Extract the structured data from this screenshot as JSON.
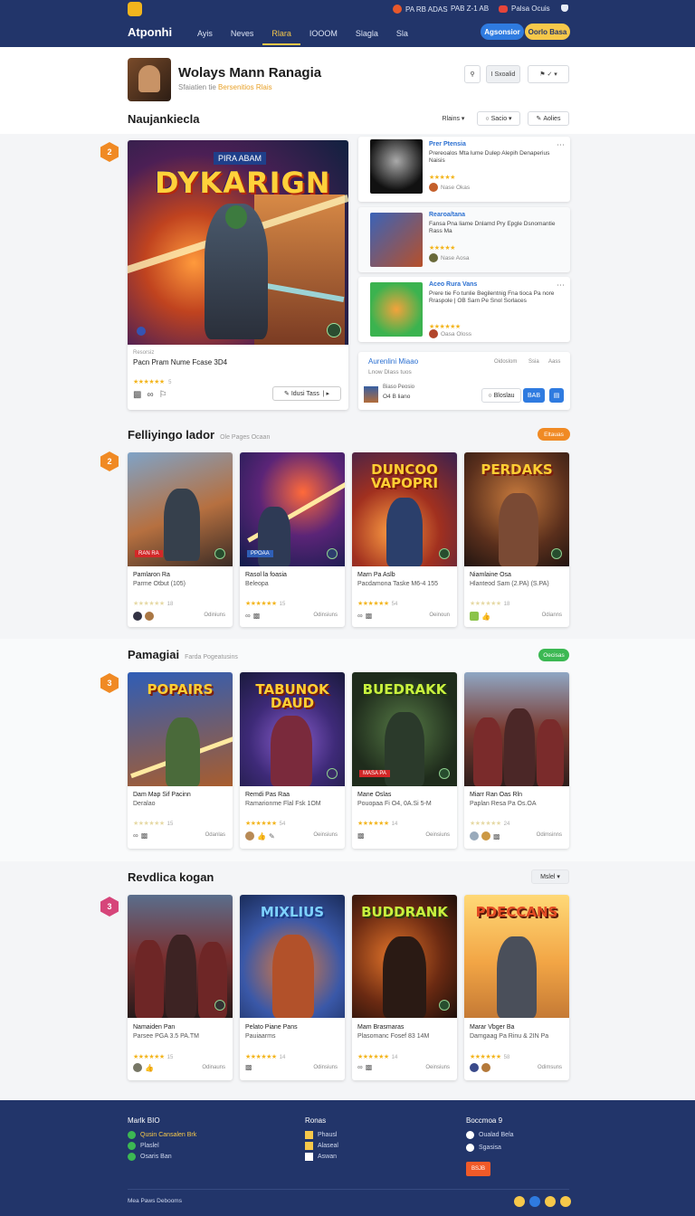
{
  "topbar": {
    "brand": "Atponhi",
    "nav": [
      "Ayis",
      "Neves",
      "Rlara",
      "IOOOM",
      "Slagla",
      "Sla"
    ],
    "active_nav": 2,
    "util": {
      "item1": "PA RB ADAS",
      "item2": "PAB Z-1 AB",
      "item3": "Palsa Ocuis"
    },
    "btn_primary": "Agsonsior",
    "btn_secondary": "Oorlo Basa"
  },
  "header": {
    "title": "Wolays Mann Ranagia",
    "subtitle_gray": "Sfaiatien tie",
    "subtitle_accent": "Bersenitios Rlais",
    "btn_share": "I Sxoalid",
    "btn_more": "✓"
  },
  "section1": {
    "title": "Naujankiecla",
    "badge": "2",
    "ctrl_sort": "Rlains",
    "ctrl_filter": "Sacio",
    "ctrl_add": "Aolies"
  },
  "featured": {
    "tag": "PIRA ABAM",
    "art_title": "DYKARIGN",
    "meta": "Resorsiz",
    "name": "Pacn Pram Nume Fcase 3D4",
    "stars": "★★★★★★",
    "rating_small": "5",
    "button": "Idusi Tass"
  },
  "side_items": [
    {
      "t1": "Prer Ptensia",
      "t2": "Prereoalos Mta lume Dulep Alepih Denaperius Naisis",
      "stars": "★★★★★",
      "small": "Nase Okas"
    },
    {
      "t1": "Rearoa/tana",
      "t2": "Fansa Pna liame Dnlamd Pry Epgle Dsnomantie Rass Ma",
      "stars": "★★★★★",
      "small": "Nase Aosa"
    },
    {
      "t1": "Aceo Rura Vans",
      "t2": "Prere tie Fo tunlie Begilentnig Fna tioca Pa nore Rraspole | OB Sarn Pe Snol Sorlaces",
      "stars": "★★★★★★",
      "small": "Oasa Oloss"
    }
  ],
  "side_footer": {
    "t1": "Aurenlini Miaao",
    "t2": "Lnow Dlass tuos",
    "meta_a": "Oidoslom",
    "meta_b": "Ssia",
    "meta_c": "Aass",
    "user_a": "Biaso Peosio",
    "user_b": "O4 B liano",
    "btn_a": "Bloslau",
    "btn_b": "BAB"
  },
  "section2": {
    "title": "Felliyingo lador",
    "subtitle": "Ole Pages Ocaan",
    "badge": "2",
    "tag": "Eltauas",
    "cards": [
      {
        "ttl": "",
        "lbl": "RAN RA",
        "n1": "Pamlaron Ra",
        "n2": "Parme Otbut (105)",
        "stars": "★★★★★★",
        "rate": "18",
        "ft2": "Odiniuns"
      },
      {
        "ttl": "",
        "lbl": "PPOAA",
        "n1": "Rasol la foasia",
        "n2": "Beleopa",
        "stars": "★★★★★★",
        "rate": "15",
        "ft2": "Odinsiuns"
      },
      {
        "ttl": "DUNCOO VAPOPRI",
        "lbl": "",
        "n1": "Marn Pa Aslb",
        "n2": "Pacdamona Taske M6-4 155",
        "stars": "★★★★★★",
        "rate": "54",
        "ft2": "Oeinoun"
      },
      {
        "ttl": "PERDAKS",
        "lbl": "",
        "n1": "Niamlaine Osa",
        "n2": "Hlanteod Sam (2.PA) (S.PA)",
        "stars": "★★★★★★",
        "rate": "18",
        "ft2": "Odianns"
      }
    ]
  },
  "section3": {
    "title": "Pamagiai",
    "subtitle": "Farda Pogeatusins",
    "badge": "3",
    "tag": "Oecisas",
    "cards": [
      {
        "ttl": "POPAIRS",
        "lbl": "",
        "n1": "Dam Map Sif Pacinn",
        "n2": "Deralao",
        "stars": "★★★★★★",
        "rate": "15",
        "ft2": "Odanlas"
      },
      {
        "ttl": "TABUNOK DAUD",
        "lbl": "",
        "n1": "Remdi Pas Raa",
        "n2": "Ramarionme Flal Fsk 1OM",
        "stars": "★★★★★★",
        "rate": "54",
        "ft2": "Oeinsiuns"
      },
      {
        "ttl": "BUEDRAKK",
        "lbl": "MASA PA",
        "n1": "Mane Oslas",
        "n2": "Pouopaa Fi O4, 0A.Si 5-M",
        "stars": "★★★★★★",
        "rate": "14",
        "ft2": "Oeinsiuns"
      },
      {
        "ttl": "",
        "lbl": "",
        "n1": "Miarr Ran Oas Rln",
        "n2": "Paplan Resa Pa Os.OA",
        "stars": "★★★★★★",
        "rate": "24",
        "ft2": "Odimsinns"
      }
    ]
  },
  "section4": {
    "title": "Revdlica kogan",
    "badge": "3",
    "ctrl": "Mslel",
    "cards": [
      {
        "ttl": "",
        "lbl": "",
        "n1": "Namaiden Pan",
        "n2": "Parsee PGA 3.5 PA.TM",
        "stars": "★★★★★★",
        "rate": "15",
        "ft2": "Odinauns"
      },
      {
        "ttl": "MIXLIUS",
        "lbl": "",
        "n1": "Pelato Piane Pans",
        "n2": "Pauiaarms",
        "stars": "★★★★★★",
        "rate": "14",
        "ft2": "Odinsiuns"
      },
      {
        "ttl": "BUDDRANK",
        "lbl": "",
        "n1": "Mam Brasmaras",
        "n2": "Plasomanc Fosef 83 14M",
        "stars": "★★★★★★",
        "rate": "14",
        "ft2": "Oeinsiuns"
      },
      {
        "ttl": "PDECCANS",
        "lbl": "",
        "n1": "Marar Vbger Ba",
        "n2": "Damgaag Pa Rinu & 2IN Pa",
        "stars": "★★★★★★",
        "rate": "58",
        "ft2": "Odimsuns"
      }
    ]
  },
  "footer": {
    "col1": {
      "title": "Marlk BIO",
      "items": [
        "Qusin Cansalen Brk",
        "Plaslel",
        "Osaris Ban"
      ]
    },
    "col2": {
      "title": "Ronas",
      "items": [
        "Phausl",
        "Alaseal",
        "Aswan"
      ]
    },
    "col3": {
      "title": "Boccmoa 9",
      "items": [
        "Oualad Bela",
        "Sgasisa"
      ],
      "button": "BSJB"
    },
    "bottom": "Mea Paws Debooms"
  },
  "colors": {
    "navy": "#22356a",
    "accent_yellow": "#f6c84a",
    "orange": "#f08a24",
    "green": "#3cb853",
    "pink": "#d6457a",
    "blue": "#2f7be0"
  }
}
